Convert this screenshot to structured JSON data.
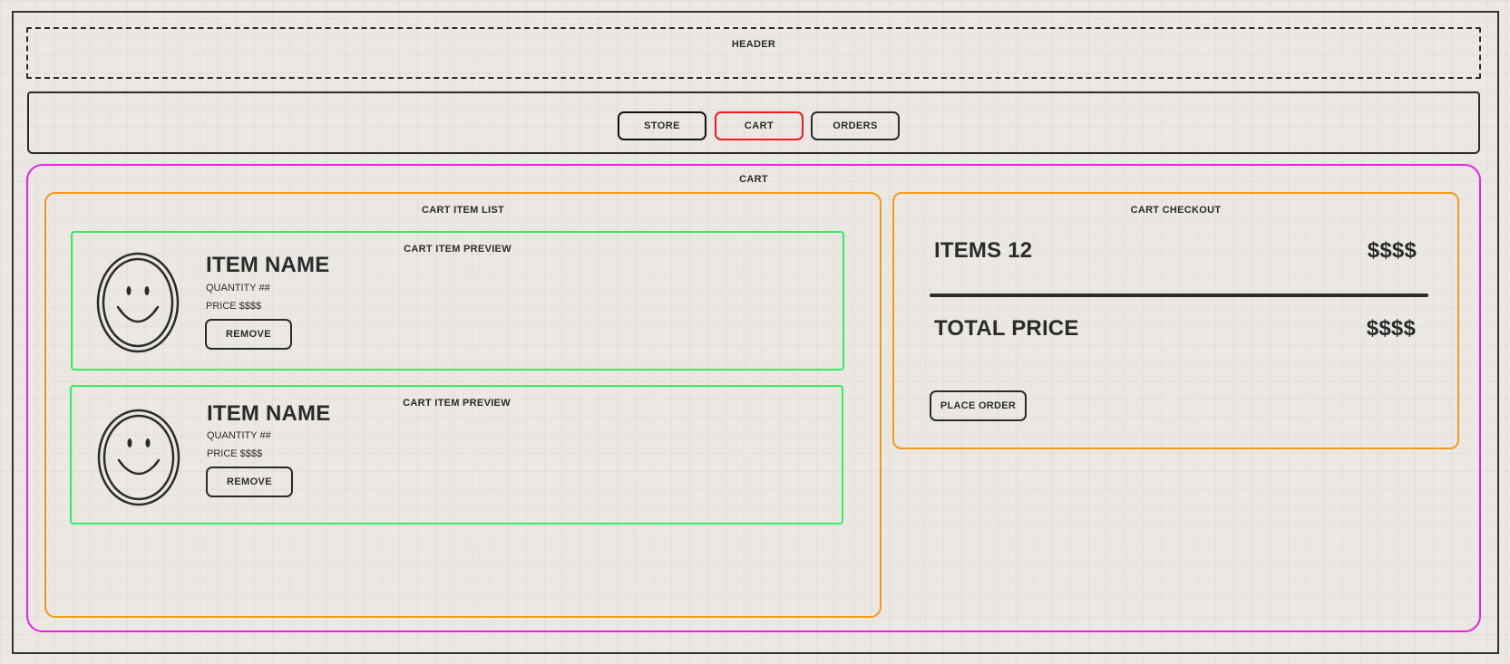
{
  "header": {
    "label": "HEADER"
  },
  "nav": {
    "items": [
      {
        "label": "STORE",
        "border_color": "#111111"
      },
      {
        "label": "CART",
        "border_color": "#ee1c1c",
        "active": true
      },
      {
        "label": "ORDERS",
        "border_color": "#2b2b2b"
      }
    ]
  },
  "cart": {
    "title": "CART",
    "border_color": "#f01ee8",
    "item_list": {
      "title": "CART ITEM LIST",
      "border_color": "#f39a14",
      "items": [
        {
          "card_title": "CART ITEM PREVIEW",
          "image_icon": "smiley-face-icon",
          "name": "ITEM NAME",
          "quantity": "QUANTITY ##",
          "price": "PRICE $$$$",
          "remove_label": "REMOVE"
        },
        {
          "card_title": "CART ITEM PREVIEW",
          "image_icon": "smiley-face-icon",
          "name": "ITEM NAME",
          "quantity": "QUANTITY ##",
          "price": "PRICE $$$$",
          "remove_label": "REMOVE"
        }
      ],
      "card_border_color": "#31ee61"
    },
    "checkout": {
      "title": "CART CHECKOUT",
      "border_color": "#f39a14",
      "items_label": "ITEMS 12",
      "items_price": "$$$$",
      "total_label": "TOTAL PRICE",
      "total_price": "$$$$",
      "place_order_label": "PLACE ORDER"
    }
  }
}
